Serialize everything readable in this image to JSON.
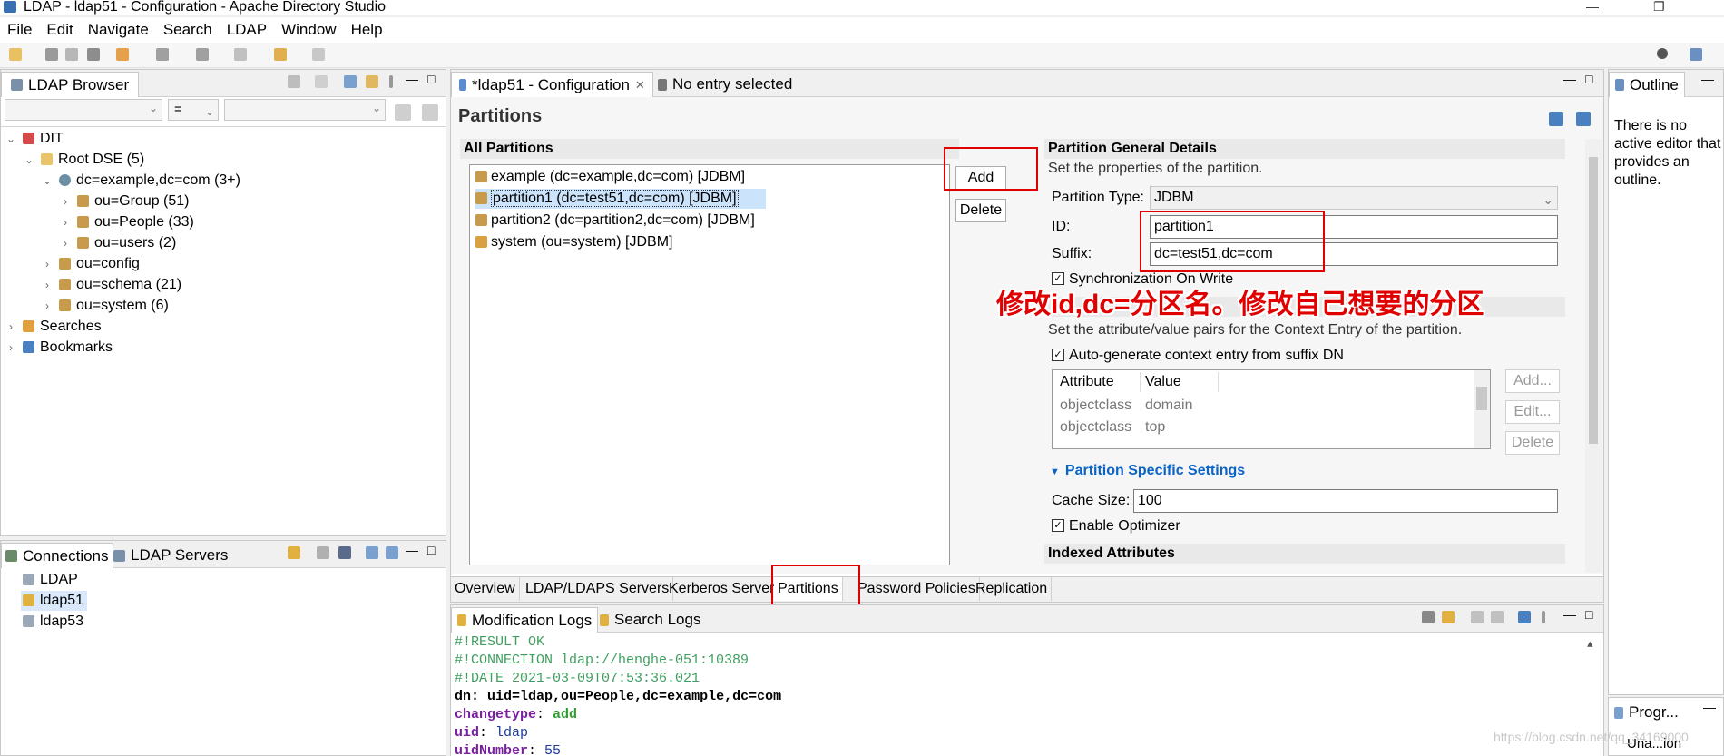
{
  "window": {
    "title": "LDAP - ldap51 - Configuration - Apache Directory Studio",
    "min": "—",
    "restore": "❐"
  },
  "menu": [
    "File",
    "Edit",
    "Navigate",
    "Search",
    "LDAP",
    "Window",
    "Help"
  ],
  "browser": {
    "tab": "LDAP Browser",
    "filter_op": "=",
    "tree": [
      {
        "label": "DIT",
        "exp": "⌄"
      },
      {
        "label": "Root DSE (5)",
        "exp": "⌄"
      },
      {
        "label": "dc=example,dc=com (3+)",
        "exp": "⌄"
      },
      {
        "label": "ou=Group (51)",
        "exp": "›"
      },
      {
        "label": "ou=People (33)",
        "exp": "›"
      },
      {
        "label": "ou=users (2)",
        "exp": "›"
      },
      {
        "label": "ou=config",
        "exp": "›"
      },
      {
        "label": "ou=schema (21)",
        "exp": "›"
      },
      {
        "label": "ou=system (6)",
        "exp": "›"
      },
      {
        "label": "Searches",
        "exp": "›"
      },
      {
        "label": "Bookmarks",
        "exp": "›"
      }
    ]
  },
  "connections": {
    "tab1": "Connections",
    "tab2": "LDAP Servers",
    "items": [
      "LDAP",
      "ldap51",
      "ldap53"
    ]
  },
  "editor": {
    "tab_active": "*ldap51 - Configuration",
    "tab_other": "No entry selected",
    "heading": "Partitions",
    "all_partitions": "All Partitions",
    "partitions": [
      "example (dc=example,dc=com) [JDBM]",
      "partition1 (dc=test51,dc=com) [JDBM]",
      "partition2 (dc=partition2,dc=com) [JDBM]",
      "system (ou=system) [JDBM]"
    ],
    "add": "Add",
    "delete": "Delete",
    "details": {
      "title": "Partition General Details",
      "desc": "Set the properties of the partition.",
      "type_label": "Partition Type:",
      "type_value": "JDBM",
      "id_label": "ID:",
      "id_value": "partition1",
      "suffix_label": "Suffix:",
      "suffix_value": "dc=test51,dc=com",
      "sync_label": "Synchronization On Write",
      "context_desc": "Set the attribute/value pairs for the Context Entry of the partition.",
      "autogen_label": "Auto-generate context entry from suffix DN",
      "attr_header": "Attribute",
      "value_header": "Value",
      "attrs": [
        {
          "attr": "objectclass",
          "value": "domain"
        },
        {
          "attr": "objectclass",
          "value": "top"
        }
      ],
      "btn_add": "Add...",
      "btn_edit": "Edit...",
      "btn_delete": "Delete",
      "specific_title": "Partition Specific Settings",
      "cache_label": "Cache Size:",
      "cache_value": "100",
      "optimizer_label": "Enable Optimizer",
      "indexed_title": "Indexed Attributes"
    },
    "annotation": "修改id,dc=分区名。修改自己想要的分区",
    "bottom_tabs": [
      "Overview",
      "LDAP/LDAPS Servers",
      "Kerberos Server",
      "Partitions",
      "Password Policies",
      "Replication"
    ]
  },
  "logs": {
    "tab1": "Modification Logs",
    "tab2": "Search Logs",
    "lines": [
      {
        "text": "#!RESULT OK"
      },
      {
        "text": "#!CONNECTION ldap://henghe-051:10389"
      },
      {
        "text": "#!DATE 2021-03-09T07:53:36.021"
      },
      {
        "key": "dn",
        "value": "uid=ldap,ou=People,dc=example,dc=com"
      },
      {
        "key": "changetype",
        "value": "add"
      },
      {
        "key": "uid",
        "value": "ldap"
      },
      {
        "key": "uidNumber",
        "value": "55"
      }
    ]
  },
  "outline": {
    "tab": "Outline",
    "text": "There is no active editor that provides an outline."
  },
  "progress": {
    "tab": "Progr...",
    "text": "Una...ion"
  },
  "watermark": "https://blog.csdn.net/qq_34169000",
  "colors": {
    "accent": "#0b63c5",
    "annotation": "#e00000",
    "comment": "#3f9f5f",
    "keyword": "#7b1fa2"
  }
}
